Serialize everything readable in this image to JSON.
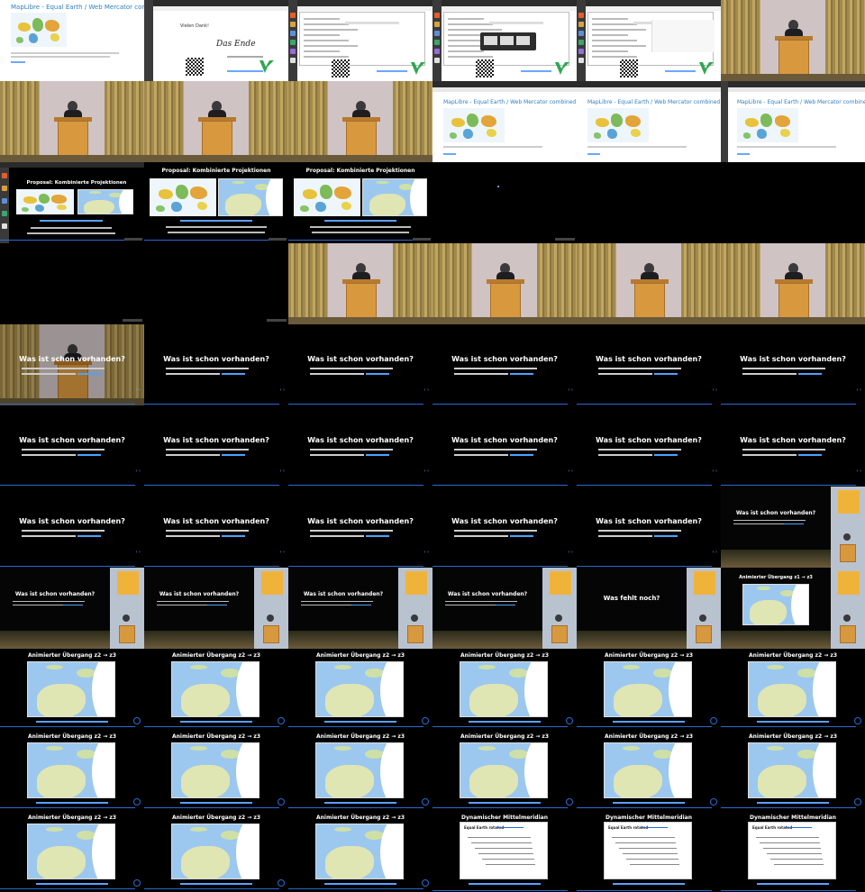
{
  "tiles": [
    {
      "type": "browser",
      "title": "MapLibre - Equal Earth / Web Mercator combined"
    },
    {
      "type": "vielen",
      "title": "Vielen Dank!",
      "ende": "Das Ende"
    },
    {
      "type": "filewin"
    },
    {
      "type": "filewin"
    },
    {
      "type": "filewin"
    },
    {
      "type": "stage"
    },
    {
      "type": "stage"
    },
    {
      "type": "stage"
    },
    {
      "type": "stage"
    },
    {
      "type": "browser",
      "title": "MapLibre - Equal Earth / Web Mercator combined"
    },
    {
      "type": "browser",
      "title": "MapLibre - Equal Earth / Web Mercator combined"
    },
    {
      "type": "browser",
      "title": "MapLibre - Equal Earth / Web Mercator combined"
    },
    {
      "type": "proj",
      "title": "Proposal: Kombinierte Projektionen",
      "small": true
    },
    {
      "type": "proj",
      "title": "Proposal: Kombinierte Projektionen"
    },
    {
      "type": "proj",
      "title": "Proposal: Kombinierte Projektionen"
    },
    {
      "type": "black"
    },
    {
      "type": "black"
    },
    {
      "type": "black"
    },
    {
      "type": "black"
    },
    {
      "type": "black"
    },
    {
      "type": "stage"
    },
    {
      "type": "stage"
    },
    {
      "type": "stage"
    },
    {
      "type": "stage"
    },
    {
      "type": "was",
      "title": "Was ist schon vorhanden?",
      "overlay": true
    },
    {
      "type": "was",
      "title": "Was ist schon vorhanden?"
    },
    {
      "type": "was",
      "title": "Was ist schon vorhanden?"
    },
    {
      "type": "was",
      "title": "Was ist schon vorhanden?"
    },
    {
      "type": "was",
      "title": "Was ist schon vorhanden?"
    },
    {
      "type": "was",
      "title": "Was ist schon vorhanden?"
    },
    {
      "type": "was",
      "title": "Was ist schon vorhanden?"
    },
    {
      "type": "was",
      "title": "Was ist schon vorhanden?"
    },
    {
      "type": "was",
      "title": "Was ist schon vorhanden?"
    },
    {
      "type": "was",
      "title": "Was ist schon vorhanden?"
    },
    {
      "type": "was",
      "title": "Was ist schon vorhanden?"
    },
    {
      "type": "was",
      "title": "Was ist schon vorhanden?"
    },
    {
      "type": "was",
      "title": "Was ist schon vorhanden?"
    },
    {
      "type": "was",
      "title": "Was ist schon vorhanden?"
    },
    {
      "type": "was",
      "title": "Was ist schon vorhanden?"
    },
    {
      "type": "was",
      "title": "Was ist schon vorhanden?"
    },
    {
      "type": "was",
      "title": "Was ist schon vorhanden?"
    },
    {
      "type": "waspip",
      "title": "Was ist schon vorhanden?"
    },
    {
      "type": "waspip",
      "title": "Was ist schon vorhanden?"
    },
    {
      "type": "waspip",
      "title": "Was ist schon vorhanden?"
    },
    {
      "type": "waspip",
      "title": "Was ist schon vorhanden?"
    },
    {
      "type": "waspip",
      "title": "Was ist schon vorhanden?"
    },
    {
      "type": "fehlt",
      "title": "Was fehlt noch?"
    },
    {
      "type": "anim1",
      "title": "Animierter Übergang z1 → z3"
    },
    {
      "type": "anim",
      "title": "Animierter Übergang z2 → z3"
    },
    {
      "type": "anim",
      "title": "Animierter Übergang z2 → z3"
    },
    {
      "type": "anim",
      "title": "Animierter Übergang z2 → z3"
    },
    {
      "type": "anim",
      "title": "Animierter Übergang z2 → z3"
    },
    {
      "type": "anim",
      "title": "Animierter Übergang z2 → z3"
    },
    {
      "type": "anim",
      "title": "Animierter Übergang z2 → z3"
    },
    {
      "type": "anim",
      "title": "Animierter Übergang z2 → z3"
    },
    {
      "type": "anim",
      "title": "Animierter Übergang z2 → z3"
    },
    {
      "type": "anim",
      "title": "Animierter Übergang z2 → z3"
    },
    {
      "type": "anim",
      "title": "Animierter Übergang z2 → z3"
    },
    {
      "type": "anim",
      "title": "Animierter Übergang z2 → z3"
    },
    {
      "type": "anim",
      "title": "Animierter Übergang z2 → z3"
    },
    {
      "type": "anim",
      "title": "Animierter Übergang z2 → z3"
    },
    {
      "type": "anim",
      "title": "Animierter Übergang z2 → z3"
    },
    {
      "type": "anim",
      "title": "Animierter Übergang z2 → z3"
    },
    {
      "type": "dyn",
      "title": "Dynamischer Mittelmeridian",
      "inner": "Equal Earth rotated"
    },
    {
      "type": "dyn",
      "title": "Dynamischer Mittelmeridian",
      "inner": "Equal Earth rotated"
    },
    {
      "type": "dyn",
      "title": "Dynamischer Mittelmeridian",
      "inner": "Equal Earth rotated"
    }
  ],
  "colors": {
    "accent": "#2a6bd0",
    "link": "#4aa3ff",
    "podium": "#d8983e"
  }
}
